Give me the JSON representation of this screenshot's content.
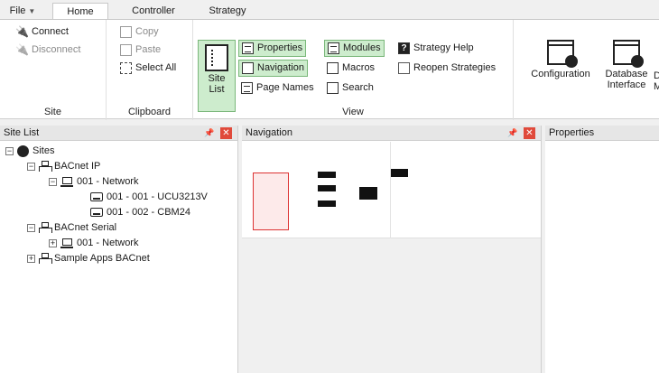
{
  "tabs": {
    "file": "File",
    "home": "Home",
    "controller": "Controller",
    "strategy": "Strategy"
  },
  "ribbon": {
    "site": {
      "label": "Site",
      "connect": "Connect",
      "disconnect": "Disconnect"
    },
    "clipboard": {
      "label": "Clipboard",
      "copy": "Copy",
      "paste": "Paste",
      "select_all": "Select All"
    },
    "view": {
      "label": "View",
      "site_list_line1": "Site",
      "site_list_line2": "List",
      "properties": "Properties",
      "navigation": "Navigation",
      "page_names": "Page Names",
      "modules": "Modules",
      "macros": "Macros",
      "search": "Search",
      "strategy_help": "Strategy Help",
      "reopen_strategies": "Reopen Strategies"
    },
    "configuration": "Configuration",
    "database_interface_line1": "Database",
    "database_interface_line2": "Interface",
    "cut_line1": "D",
    "cut_line2": "M"
  },
  "site_list": {
    "title": "Site List",
    "nodes": {
      "sites": "Sites",
      "bacnet_ip": "BACnet IP",
      "net_ip": "001 - Network",
      "dev1": "001 - 001 - UCU3213V",
      "dev2": "001 - 002 - CBM24",
      "bacnet_serial": "BACnet Serial",
      "net_serial": "001 - Network",
      "sample_apps": "Sample Apps BACnet"
    }
  },
  "navigation": {
    "title": "Navigation"
  },
  "properties": {
    "title": "Properties"
  }
}
